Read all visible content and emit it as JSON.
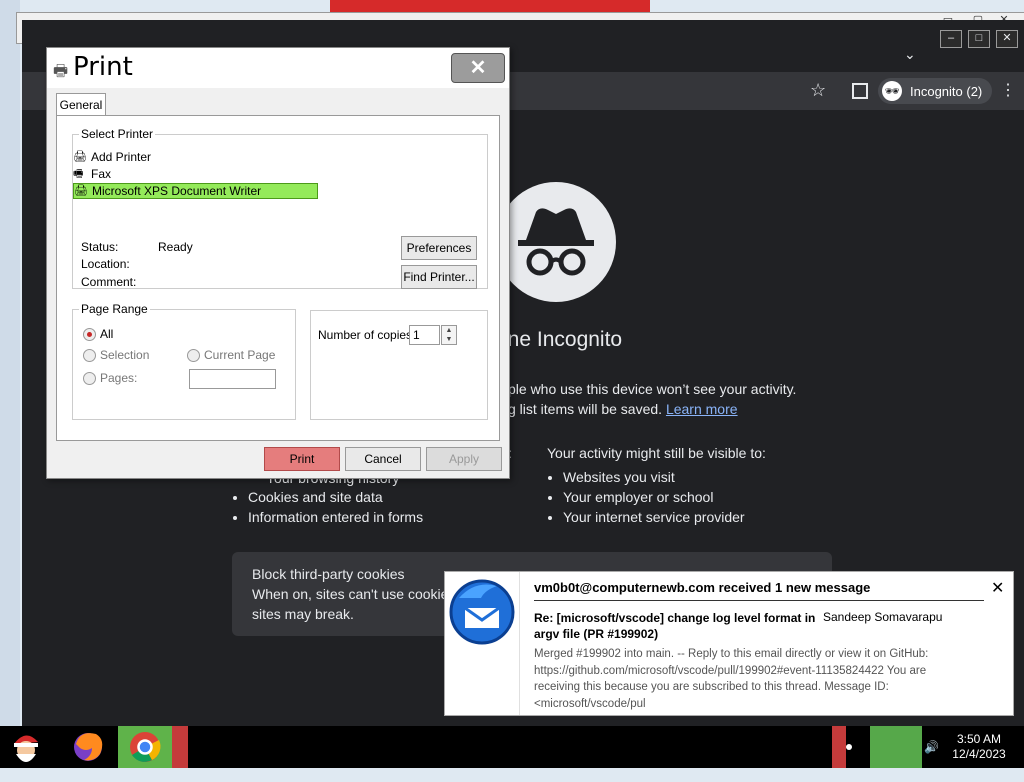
{
  "browser": {
    "incognito_label": "Incognito (2)",
    "heading": "one Incognito",
    "para_line1": "ple who use this device won’t see your activity.",
    "para_line2": "g list items will be saved.",
    "learn_more": "Learn more",
    "left_list_heading": ":",
    "left_list": [
      "Cookies and site data",
      "Information entered in forms"
    ],
    "left_list_partial": "Your browsing history",
    "right_heading": "Your activity might still be visible to:",
    "right_list": [
      "Websites you visit",
      "Your employer or school",
      "Your internet service provider"
    ],
    "cookie_title": "Block third-party cookies",
    "cookie_line1": "When on, sites can't use cookie",
    "cookie_line2": "sites may break."
  },
  "print_dialog": {
    "title": "Print",
    "tab": "General",
    "select_printer_legend": "Select Printer",
    "printers": [
      "Add Printer",
      "Fax",
      "Microsoft XPS Document Writer"
    ],
    "status_label": "Status:",
    "status_value": "Ready",
    "location_label": "Location:",
    "comment_label": "Comment:",
    "preferences_btn": "Preferences",
    "find_printer_btn": "Find Printer...",
    "page_range_legend": "Page Range",
    "radio_all": "All",
    "radio_selection": "Selection",
    "radio_current": "Current Page",
    "radio_pages": "Pages:",
    "copies_label": "Number of copies:",
    "copies_value": "1",
    "print_btn": "Print",
    "cancel_btn": "Cancel",
    "apply_btn": "Apply"
  },
  "notification": {
    "sender": "vm0b0t@computernewb.com received 1 new message",
    "subject": "Re: [microsoft/vscode] change log level format in argv file (PR #199902)",
    "from": "Sandeep Somavarapu",
    "body": "Merged #199902 into main. -- Reply to this email directly or view it on GitHub: https://github.com/microsoft/vscode/pull/199902#event-11135824422 You are receiving this because you are subscribed to this thread. Message ID: <microsoft/vscode/pul",
    "close": "✕"
  },
  "taskbar": {
    "time": "3:50 AM",
    "date": "12/4/2023"
  }
}
